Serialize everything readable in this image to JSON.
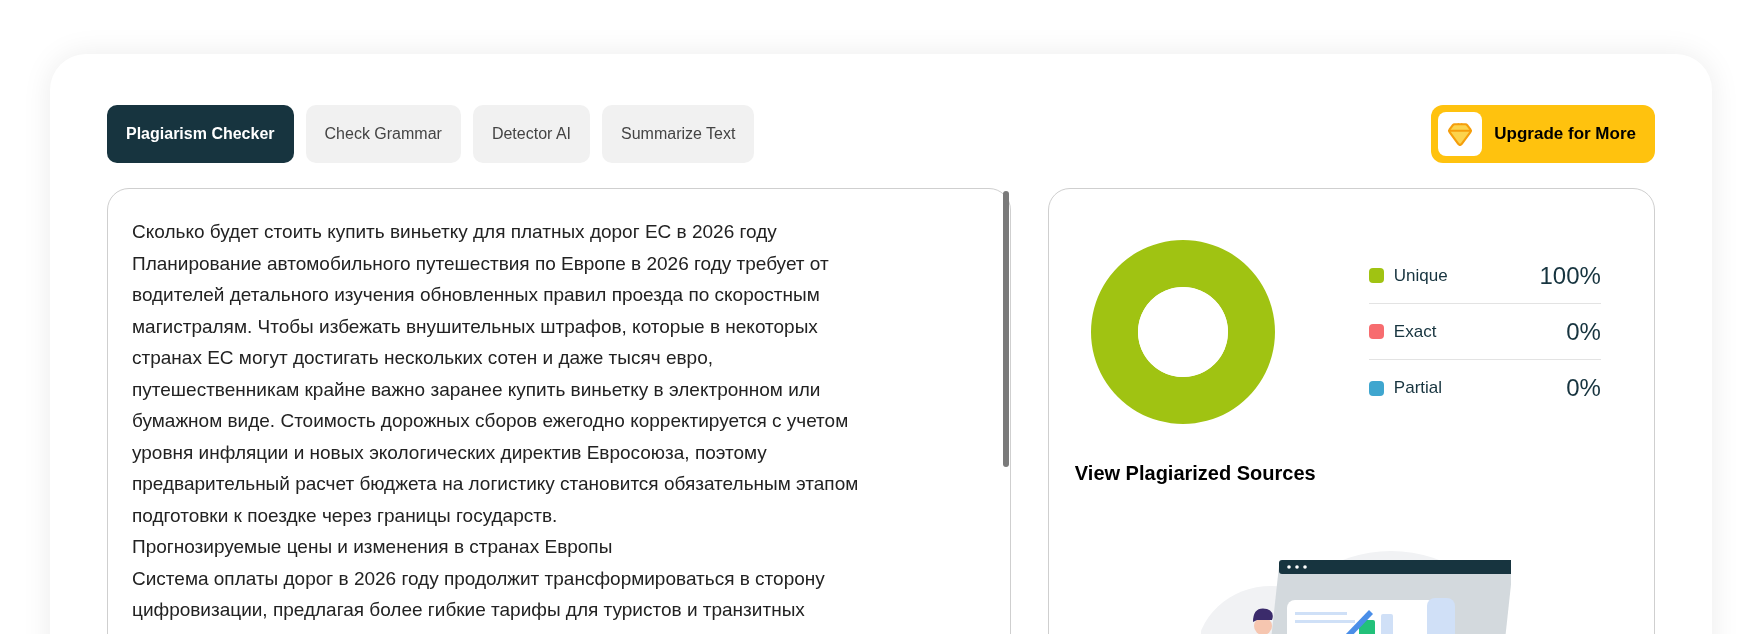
{
  "tabs": [
    {
      "label": "Plagiarism Checker",
      "selected": true
    },
    {
      "label": "Check Grammar",
      "selected": false
    },
    {
      "label": "Detector AI",
      "selected": false
    },
    {
      "label": "Summarize Text",
      "selected": false
    }
  ],
  "upgrade_button": {
    "label": "Upgrade for More"
  },
  "editor": {
    "paragraphs": [
      "Сколько будет стоить купить виньетку для платных дорог ЕС в 2026 году",
      "Планирование автомобильного путешествия по Европе в 2026 году требует от водителей детального изучения обновленных правил проезда по скоростным магистралям. Чтобы избежать внушительных штрафов, которые в некоторых странах ЕС могут достигать нескольких сотен и даже тысяч евро, путешественникам крайне важно заранее купить виньетку в электронном или бумажном виде. Стоимость дорожных сборов ежегодно корректируется с учетом уровня инфляции и новых экологических директив Евросоюза, поэтому предварительный расчет бюджета на логистику становится обязательным этапом подготовки к поездке через границы государств.",
      "Прогнозируемые цены и изменения в странах Европы",
      "Система оплаты дорог в 2026 году продолжит трансформироваться в сторону цифровизации, предлагая более гибкие тарифы для туристов и транзитных"
    ]
  },
  "results": {
    "chart_data": {
      "type": "donut",
      "categories": [
        "Unique",
        "Exact",
        "Partial"
      ],
      "values": [
        100,
        0,
        0
      ]
    },
    "legend": [
      {
        "value": "100%",
        "color": "#a0c312"
      },
      {
        "value": "0%",
        "color": "#f76c6f"
      },
      {
        "value": "0%",
        "color": "#3fa6cf"
      }
    ],
    "sources_title": "View Plagiarized Sources"
  }
}
